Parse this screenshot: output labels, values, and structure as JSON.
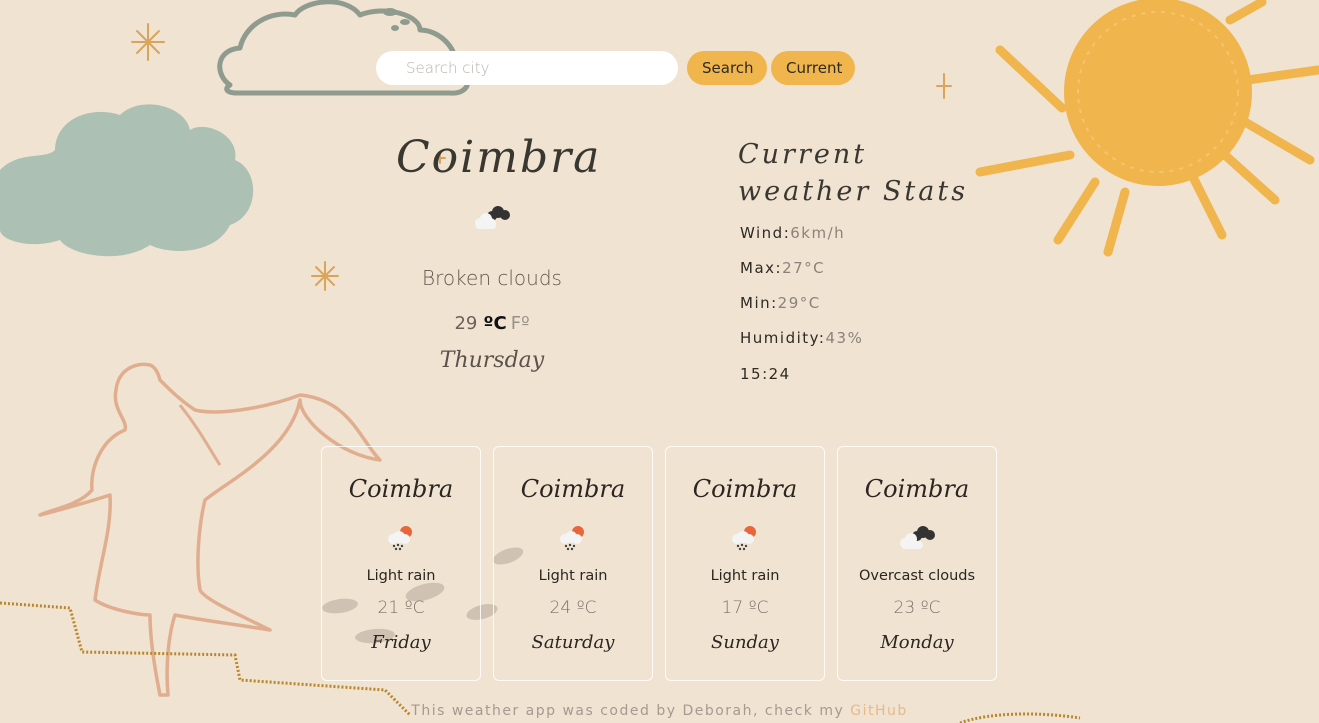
{
  "search": {
    "placeholder": "Search city",
    "search_label": "Search",
    "current_label": "Current"
  },
  "current": {
    "city": "Coimbra",
    "icon": "broken-clouds-icon",
    "description": "Broken clouds",
    "temperature": "29",
    "unit_celsius": "ºC",
    "unit_fahrenheit": "Fº",
    "day": "Thursday"
  },
  "stats": {
    "title": "Current weather Stats",
    "wind_label": "Wind:",
    "wind_value": "6km/h",
    "max_label": "Max:",
    "max_value": "27°C",
    "min_label": "Min:",
    "min_value": "29°C",
    "humidity_label": "Humidity:",
    "humidity_value": "43%",
    "time": "15:24"
  },
  "forecast": [
    {
      "city": "Coimbra",
      "icon": "light-rain-icon",
      "description": "Light rain",
      "temperature": "21 ºC",
      "day": "Friday"
    },
    {
      "city": "Coimbra",
      "icon": "light-rain-icon",
      "description": "Light rain",
      "temperature": "24 ºC",
      "day": "Saturday"
    },
    {
      "city": "Coimbra",
      "icon": "light-rain-icon",
      "description": "Light rain",
      "temperature": "17 ºC",
      "day": "Sunday"
    },
    {
      "city": "Coimbra",
      "icon": "overcast-clouds-icon",
      "description": "Overcast clouds",
      "temperature": "23 ºC",
      "day": "Monday"
    }
  ],
  "footer": {
    "text": "This weather app was coded by Deborah, check my ",
    "link_label": "GitHub"
  },
  "colors": {
    "background": "#f0e3d2",
    "accent": "#f0b54c",
    "sun": "#f0b54c",
    "cloud_green": "#adc0b4",
    "cloud_outline": "#8f9a8f",
    "figure_outline": "#e0ae8f"
  }
}
